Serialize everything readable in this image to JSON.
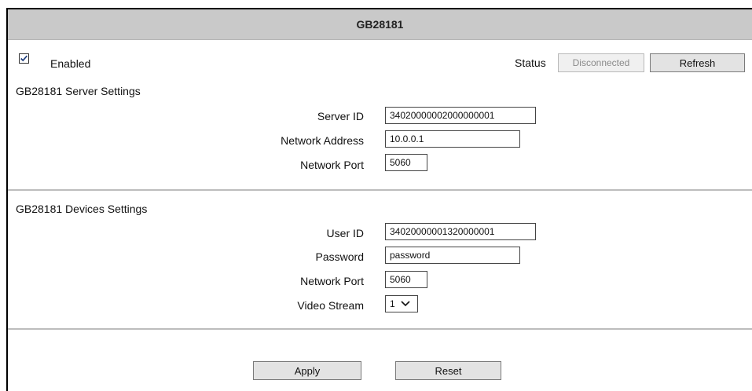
{
  "window": {
    "title": "GB28181"
  },
  "enabled": {
    "label": "Enabled",
    "checked": true
  },
  "status": {
    "label": "Status",
    "value": "Disconnected",
    "refresh_label": "Refresh"
  },
  "server": {
    "section_title": "GB28181 Server Settings",
    "server_id_label": "Server ID",
    "server_id_value": "34020000002000000001",
    "address_label": "Network Address",
    "address_value": "10.0.0.1",
    "port_label": "Network Port",
    "port_value": "5060"
  },
  "devices": {
    "section_title": "GB28181 Devices Settings",
    "user_id_label": "User ID",
    "user_id_value": "34020000001320000001",
    "password_label": "Password",
    "password_value": "password",
    "port_label": "Network Port",
    "port_value": "5060",
    "stream_label": "Video Stream",
    "stream_value": "1"
  },
  "actions": {
    "apply_label": "Apply",
    "reset_label": "Reset"
  },
  "icons": {
    "checkbox": "check-icon",
    "dropdown": "chevron-down-icon"
  }
}
